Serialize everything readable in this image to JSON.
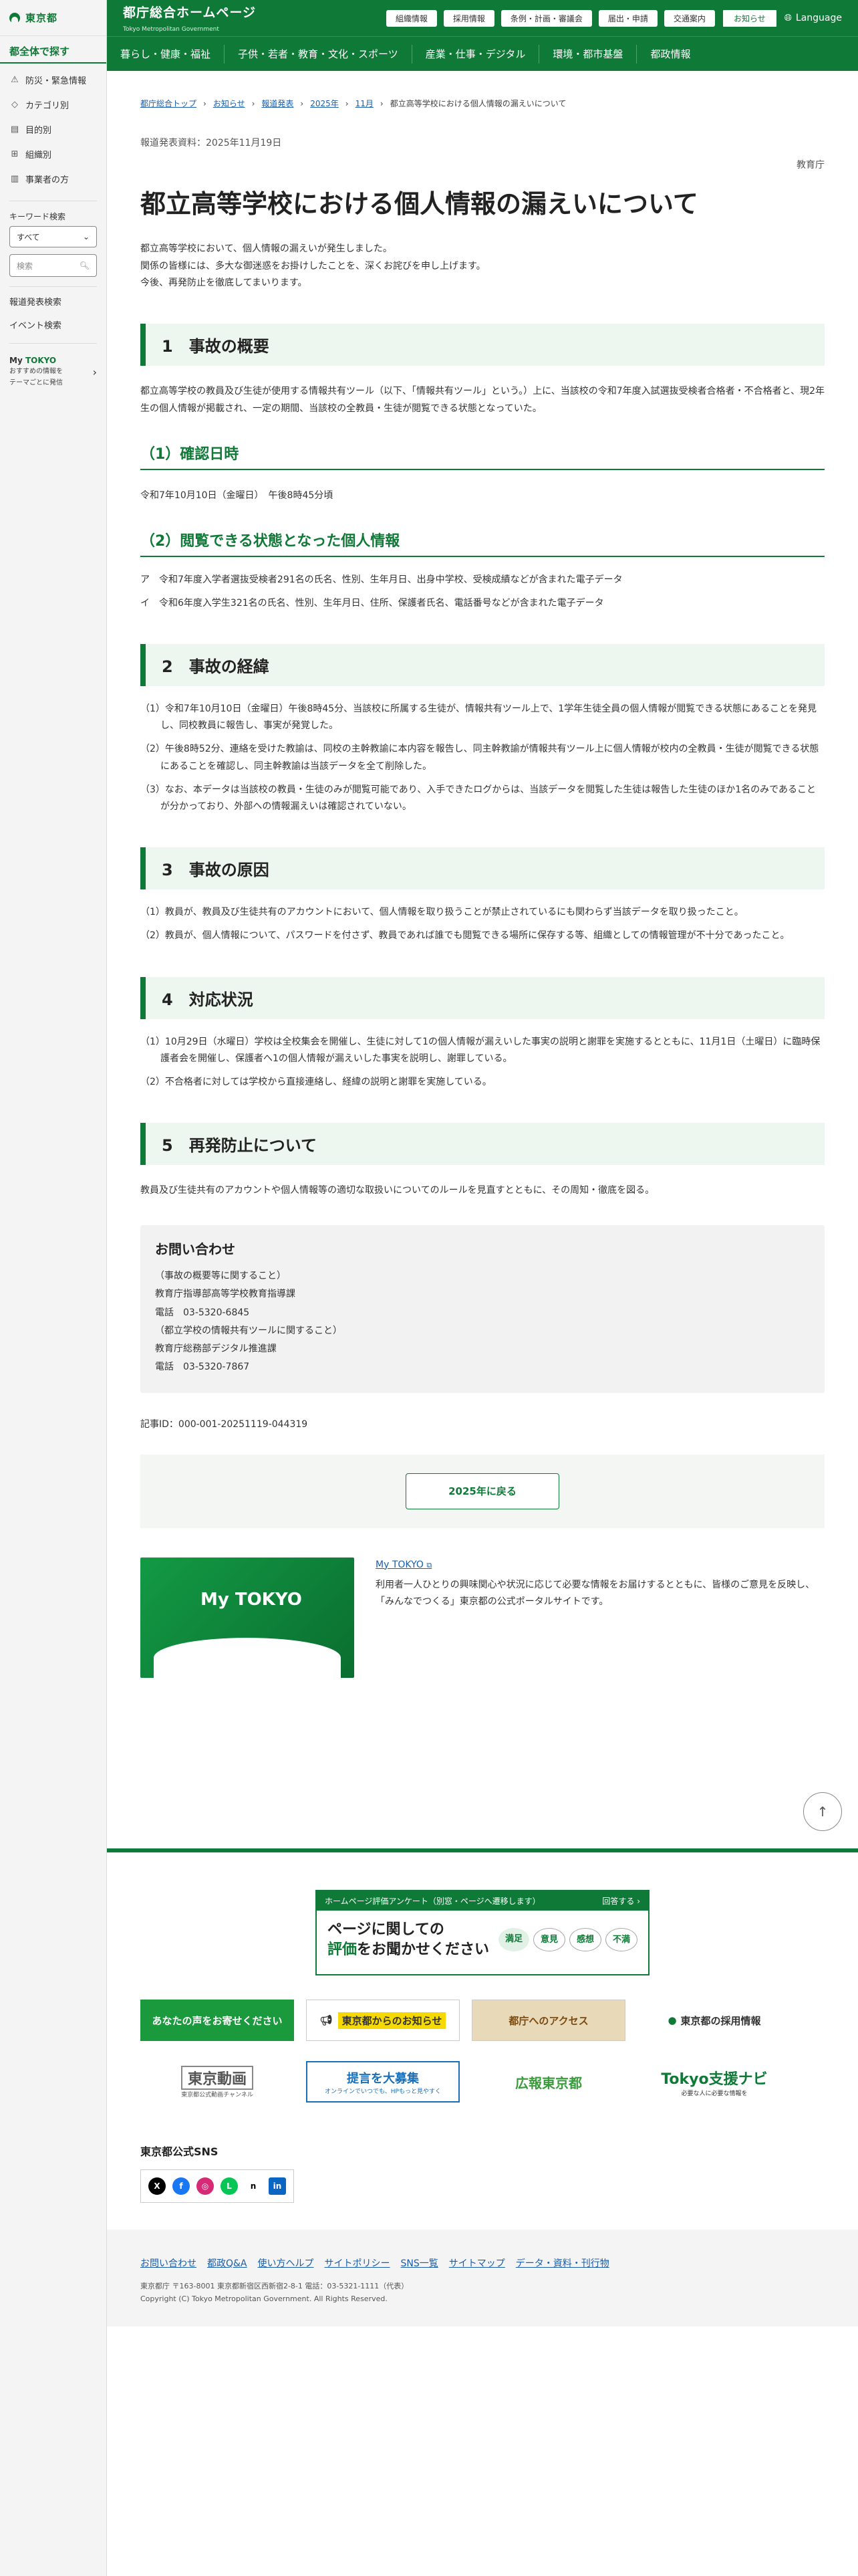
{
  "sidebar": {
    "logo": "東京都",
    "title": "都全体で探す",
    "items": [
      {
        "label": "防災・緊急情報",
        "icon": "warning-icon"
      },
      {
        "label": "カテゴリ別",
        "icon": "tag-icon"
      },
      {
        "label": "目的別",
        "icon": "document-icon"
      },
      {
        "label": "組織別",
        "icon": "org-icon"
      },
      {
        "label": "事業者の方",
        "icon": "building-icon"
      }
    ],
    "keyword_label": "キーワード検索",
    "select_value": "すべて",
    "search_placeholder": "検索",
    "links": [
      "報道発表検索",
      "イベント検索"
    ],
    "mytokyo_label_pre": "My ",
    "mytokyo_label": "TOKYO",
    "mytokyo_sub1": "おすすめの情報を",
    "mytokyo_sub2": "テーマごとに発信"
  },
  "header": {
    "title": "都庁総合ホームページ",
    "subtitle": "Tokyo Metropolitan Government",
    "util": [
      "組織情報",
      "採用情報",
      "条例・計画・審議会",
      "届出・申請",
      "交通案内"
    ],
    "notice": "お知らせ",
    "lang": "Language"
  },
  "gnav": [
    "暮らし・健康・福祉",
    "子供・若者・教育・文化・スポーツ",
    "産業・仕事・デジタル",
    "環境・都市基盤",
    "都政情報"
  ],
  "breadcrumb": [
    "都庁総合トップ",
    "お知らせ",
    "報道発表",
    "2025年",
    "11月",
    "都立高等学校における個人情報の漏えいについて"
  ],
  "press_date": "報道発表資料：2025年11月19日",
  "department": "教育庁",
  "page_title": "都立高等学校における個人情報の漏えいについて",
  "lead": [
    "都立高等学校において、個人情報の漏えいが発生しました。",
    "関係の皆様には、多大な御迷惑をお掛けしたことを、深くお詫びを申し上げます。",
    "今後、再発防止を徹底してまいります。"
  ],
  "s1": {
    "heading": "1　事故の概要",
    "text": "都立高等学校の教員及び生徒が使用する情報共有ツール（以下、「情報共有ツール」という。）上に、当該校の令和7年度入試選抜受検者合格者・不合格者と、現2年生の個人情報が掲載され、一定の期間、当該校の全教員・生徒が閲覧できる状態となっていた。",
    "sub1": "（1）確認日時",
    "datetime": "令和7年10月10日（金曜日）　午後8時45分頃",
    "sub2": "（2）閲覧できる状態となった個人情報",
    "items": [
      "ア　令和7年度入学者選抜受検者291名の氏名、性別、生年月日、出身中学校、受検成績などが含まれた電子データ",
      "イ　令和6年度入学生321名の氏名、性別、生年月日、住所、保護者氏名、電話番号などが含まれた電子データ"
    ]
  },
  "s2": {
    "heading": "2　事故の経緯",
    "items": [
      "（1）令和7年10月10日（金曜日）午後8時45分、当該校に所属する生徒が、情報共有ツール上で、1学年生徒全員の個人情報が閲覧できる状態にあることを発見し、同校教員に報告し、事実が発覚した。",
      "（2）午後8時52分、連絡を受けた教諭は、同校の主幹教諭に本内容を報告し、同主幹教諭が情報共有ツール上に個人情報が校内の全教員・生徒が閲覧できる状態にあることを確認し、同主幹教諭は当該データを全て削除した。",
      "（3）なお、本データは当該校の教員・生徒のみが閲覧可能であり、入手できたログからは、当該データを閲覧した生徒は報告した生徒のほか1名のみであることが分かっており、外部への情報漏えいは確認されていない。"
    ]
  },
  "s3": {
    "heading": "3　事故の原因",
    "items": [
      "（1）教員が、教員及び生徒共有のアカウントにおいて、個人情報を取り扱うことが禁止されているにも関わらず当該データを取り扱ったこと。",
      "（2）教員が、個人情報について、パスワードを付さず、教員であれば誰でも閲覧できる場所に保存する等、組織としての情報管理が不十分であったこと。"
    ]
  },
  "s4": {
    "heading": "4　対応状況",
    "items": [
      "（1）10月29日（水曜日）学校は全校集会を開催し、生徒に対して1の個人情報が漏えいした事実の説明と謝罪を実施するとともに、11月1日（土曜日）に臨時保護者会を開催し、保護者へ1の個人情報が漏えいした事実を説明し、謝罪している。",
      "（2）不合格者に対しては学校から直接連絡し、経緯の説明と謝罪を実施している。"
    ]
  },
  "s5": {
    "heading": "5　再発防止について",
    "text": "教員及び生徒共有のアカウントや個人情報等の適切な取扱いについてのルールを見直すとともに、その周知・徹底を図る。"
  },
  "contact": {
    "heading": "お問い合わせ",
    "lines": [
      "（事故の概要等に関すること）",
      "教育庁指導部高等学校教育指導課",
      "電話　03-5320-6845",
      "（都立学校の情報共有ツールに関すること）",
      "教育庁総務部デジタル推進課",
      "電話　03-5320-7867"
    ]
  },
  "article_id": "記事ID：000-001-20251119-044319",
  "back_button": "2025年に戻る",
  "mytokyo": {
    "banner_text": "My TOKYO",
    "link": "My TOKYO",
    "desc": "利用者一人ひとりの興味関心や状況に応じて必要な情報をお届けするとともに、皆様のご意見を反映し、「みんなでつくる」東京都の公式ポータルサイトです。"
  },
  "footer": {
    "survey_top": "ホームページ評価アンケート（別窓・ページへ遷移します）",
    "survey_answer": "回答する ›",
    "survey_line1": "ページに関しての",
    "survey_line2_em": "評価",
    "survey_line2_rest": "をお聞かせください",
    "survey_bubbles": [
      "満足",
      "意見",
      "感想",
      "不満"
    ],
    "banners": [
      "あなたの声をお寄せください",
      "東京都からのお知らせ",
      "都庁へのアクセス",
      "東京都の採用情報",
      "東京動画",
      "提言を大募集",
      "広報東京都",
      "Tokyo支援ナビ"
    ],
    "banner_subs": [
      "",
      "",
      "",
      "",
      "東京都公式動画チャンネル",
      "オンラインでいつでも、HPもっと見やすく",
      "",
      "必要な人に必要な情報を"
    ],
    "sns_title": "東京都公式SNS",
    "links": [
      "お問い合わせ",
      "都政Q&A",
      "使い方ヘルプ",
      "サイトポリシー",
      "SNS一覧",
      "サイトマップ",
      "データ・資料・刊行物"
    ],
    "address": "東京都庁 〒163-8001 東京都新宿区西新宿2-8-1 電話：03-5321-1111（代表）",
    "copyright": "Copyright (C) Tokyo Metropolitan Government. All Rights Reserved."
  },
  "colors": {
    "brand": "#0f7a37",
    "link": "#1a5eab",
    "section_bg": "#eef6f0"
  }
}
